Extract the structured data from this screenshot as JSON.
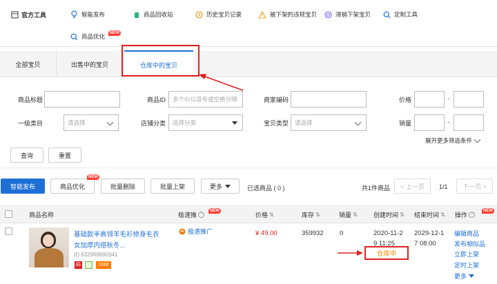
{
  "toolbar": {
    "title": "官方工具",
    "tools": [
      {
        "label": "智能发布"
      },
      {
        "label": "商品回收站"
      },
      {
        "label": "历史宝贝记录"
      },
      {
        "label": "被下架的违规宝贝"
      },
      {
        "label": "滞销下架宝贝"
      },
      {
        "label": "定制工具"
      },
      {
        "label": "商品优化",
        "badge": "NEW"
      }
    ]
  },
  "tabs": [
    {
      "label": "全部宝贝"
    },
    {
      "label": "出售中的宝贝"
    },
    {
      "label": "仓库中的宝贝",
      "active": true
    }
  ],
  "filters": {
    "title_label": "商品标题",
    "id_label": "商品ID",
    "id_placeholder": "多个ID以逗号或空格分隔",
    "code_label": "商家编码",
    "price_label": "价格",
    "range_sep": "-",
    "cat1_label": "一级类目",
    "cat1_value": "请选择",
    "shopcat_label": "店铺分类",
    "shopcat_value": "选择分类",
    "type_label": "宝贝类型",
    "type_value": "请选择",
    "sales_label": "销量",
    "expand_label": "展开更多筛选条件",
    "query_label": "查询",
    "reset_label": "重置"
  },
  "actions": {
    "publish": "智能发布",
    "optimize": "商品优化",
    "optimize_badge": "NEW",
    "batch_delete": "批量删除",
    "batch_list": "批量上架",
    "more": "更多",
    "selected": "已选商品 ( 0 )",
    "total": "共1件商品",
    "prev": "< 上一页",
    "page": "1/1",
    "next": "下一页 >"
  },
  "table": {
    "headers": {
      "name": "商品名称",
      "promo": "极速推",
      "promo_badge": "NEW",
      "price": "价格",
      "stock": "库存",
      "sales": "销量",
      "created": "创建时间",
      "ends": "结束时间",
      "ops": "操作",
      "ops_badge": "NEW"
    },
    "rows": [
      {
        "title_line1": "基础款半高领羊毛衫修身毛衣",
        "title_line2": "女加厚内搭秋冬...",
        "id": "ID:632969890941",
        "tag_red": "码",
        "tag_num": "1688",
        "promo": "极速推广",
        "price": "¥ 49.00",
        "stock": "359932",
        "sales": "0",
        "created_l1": "2020-11-2",
        "created_l2": "9 11:25",
        "status": "仓库中",
        "ends_l1": "2029-12-1",
        "ends_l2": "7 08:00",
        "ops": [
          "编辑商品",
          "发布相似品",
          "立即上架",
          "定时上架",
          "更多"
        ]
      }
    ]
  },
  "colors": {
    "accent": "#1d6fd6",
    "highlight": "#e02020",
    "status": "#f08a00"
  }
}
